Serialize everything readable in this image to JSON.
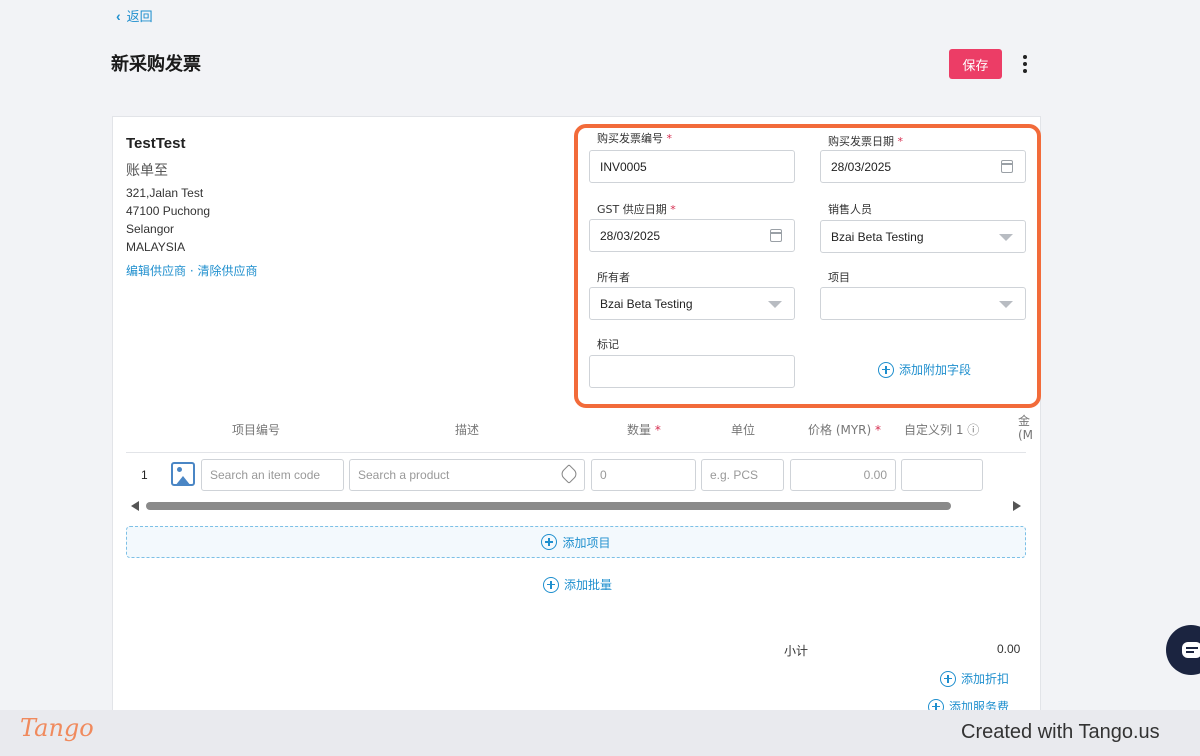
{
  "nav": {
    "back_label": "返回"
  },
  "header": {
    "title": "新采购发票",
    "save_label": "保存"
  },
  "supplier": {
    "name": "TestTest",
    "bill_to": "账单至",
    "address": [
      "321,Jalan Test",
      "47100 Puchong",
      "Selangor",
      "MALAYSIA"
    ],
    "edit_link": "编辑供应商",
    "separator": "·",
    "clear_link": "清除供应商"
  },
  "form": {
    "invoice_no": {
      "label": "购买发票编号",
      "value": "INV0005"
    },
    "invoice_date": {
      "label": "购买发票日期",
      "value": "28/03/2025"
    },
    "gst_date": {
      "label": "GST 供应日期",
      "value": "28/03/2025"
    },
    "salesperson": {
      "label": "销售人员",
      "value": "Bzai Beta Testing"
    },
    "owner": {
      "label": "所有者",
      "value": "Bzai Beta Testing"
    },
    "project": {
      "label": "项目",
      "value": ""
    },
    "remark": {
      "label": "标记",
      "value": ""
    },
    "add_field": "添加附加字段",
    "required_mark": "*"
  },
  "table": {
    "headers": {
      "item_code": "项目编号",
      "description": "描述",
      "quantity": "数量",
      "unit": "单位",
      "price": "价格 (MYR)",
      "custom1": "自定义列 1",
      "clipped_a": "金",
      "clipped_b": "(M"
    },
    "row": {
      "number": "1",
      "item_code_placeholder": "Search an item code",
      "product_placeholder": "Search a product",
      "qty_placeholder": "0",
      "unit_placeholder": "e.g. PCS",
      "price_placeholder": "0.00"
    },
    "add_item": "添加项目",
    "add_batch": "添加批量"
  },
  "totals": {
    "subtotal_label": "小计",
    "subtotal_value": "0.00",
    "add_discount": "添加折扣",
    "add_service": "添加服务费"
  },
  "footer": {
    "logo": "Tango",
    "created": "Created with Tango.us"
  },
  "colors": {
    "accent": "#1f8fce",
    "save": "#ec3d66",
    "highlight": "#f26b3a",
    "required": "#d62d4f"
  }
}
